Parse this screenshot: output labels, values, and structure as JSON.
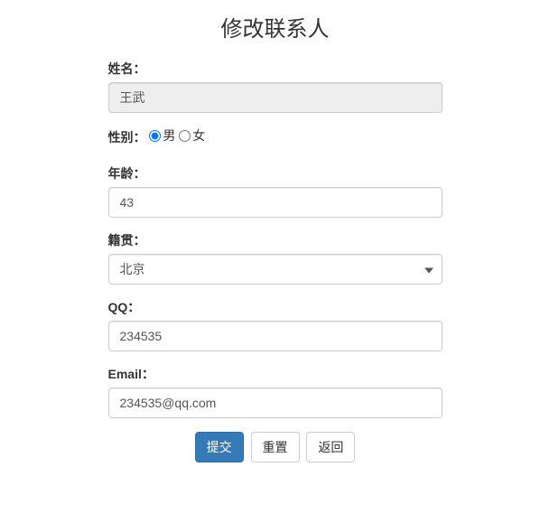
{
  "title": "修改联系人",
  "fields": {
    "name": {
      "label": "姓名：",
      "value": "王武"
    },
    "gender": {
      "label": "性别：",
      "options": {
        "male": "男",
        "female": "女"
      },
      "selected": "male"
    },
    "age": {
      "label": "年龄：",
      "value": "43"
    },
    "province": {
      "label": "籍贯：",
      "selected": "北京"
    },
    "qq": {
      "label": "QQ：",
      "value": "234535"
    },
    "email": {
      "label": "Email：",
      "value": "234535@qq.com"
    }
  },
  "buttons": {
    "submit": "提交",
    "reset": "重置",
    "back": "返回"
  }
}
